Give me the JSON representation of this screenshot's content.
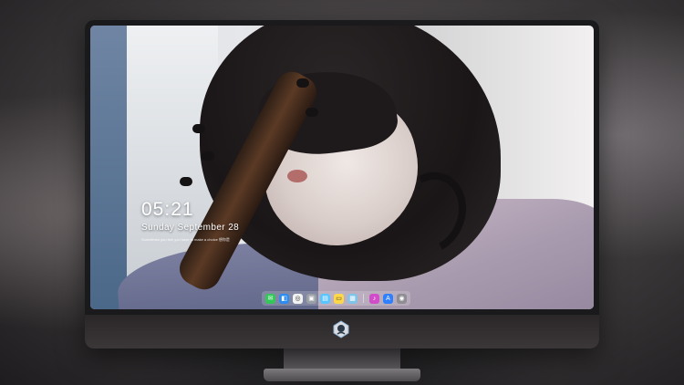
{
  "lockscreen": {
    "time": "05:21",
    "date": "Sunday September 28",
    "quote": "Sometimes you feel you have to make a choice 想你是"
  },
  "dock": {
    "items": [
      {
        "name": "messages-icon",
        "glyph": "✉",
        "color": "#34c759"
      },
      {
        "name": "finder-icon",
        "glyph": "◧",
        "color": "#2d8cf0"
      },
      {
        "name": "safari-icon",
        "glyph": "◎",
        "color": "#f2f2f2"
      },
      {
        "name": "photos-icon",
        "glyph": "▣",
        "color": "#9aa0a6"
      },
      {
        "name": "clapper-icon",
        "glyph": "▤",
        "color": "#58c5ff"
      },
      {
        "name": "notes-icon",
        "glyph": "▭",
        "color": "#ffd84a"
      },
      {
        "name": "preview-icon",
        "glyph": "▦",
        "color": "#7fc4e8"
      },
      {
        "name": "music-icon",
        "glyph": "♪",
        "color": "#d04cc8"
      },
      {
        "name": "app-store-icon",
        "glyph": "A",
        "color": "#2f7fff"
      },
      {
        "name": "camera-icon",
        "glyph": "◉",
        "color": "#8e8e93"
      }
    ]
  },
  "colors": {
    "bezel": "#1a1a1c",
    "chin": "#2a2729",
    "text": "#ffffff"
  }
}
